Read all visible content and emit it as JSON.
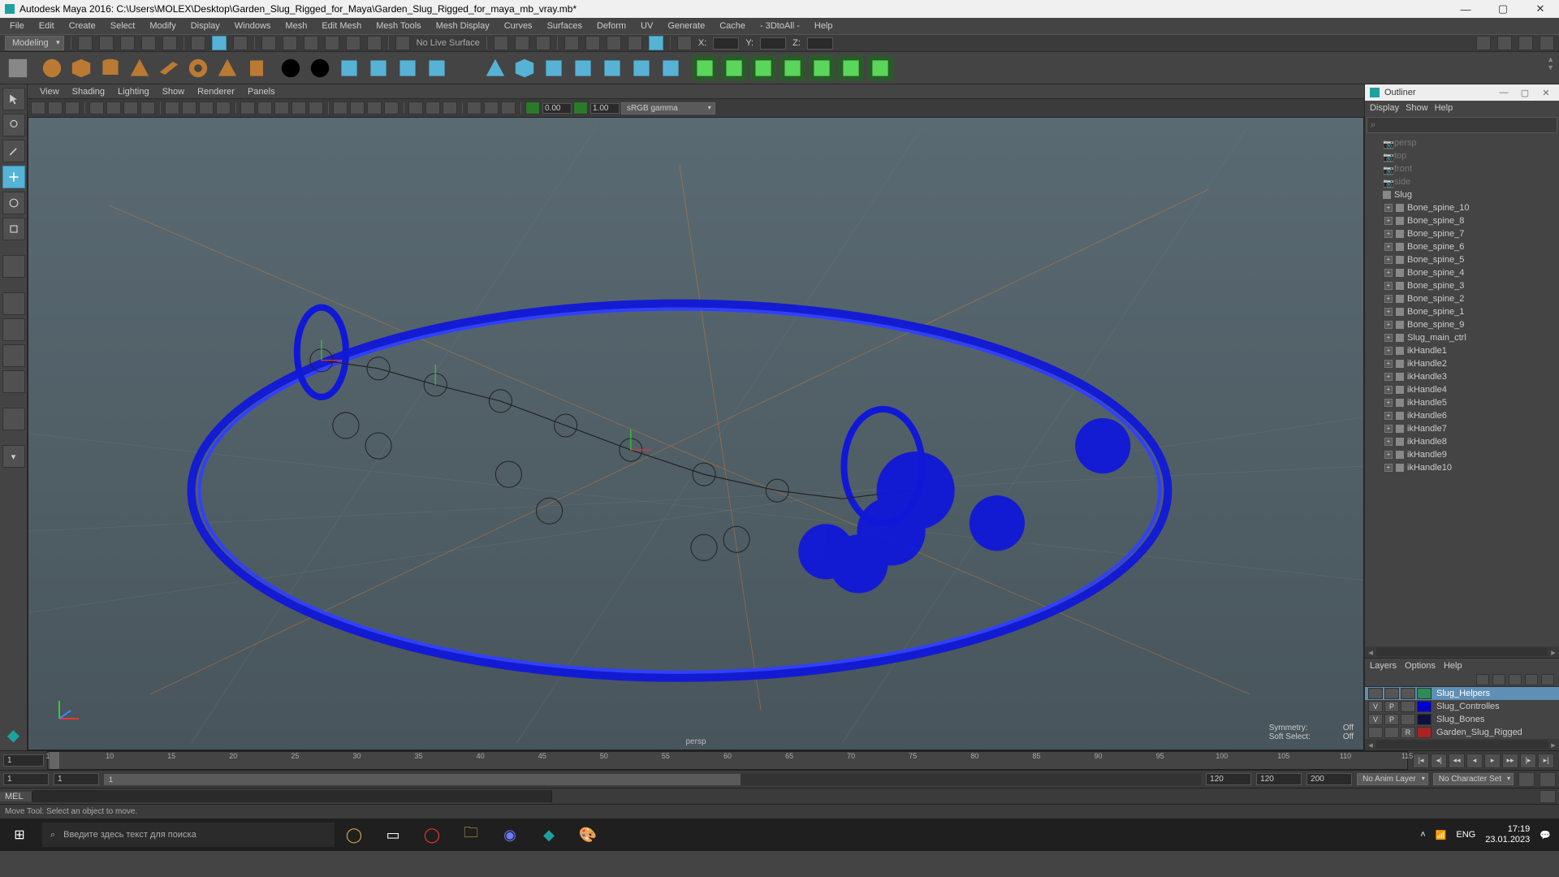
{
  "window": {
    "title": "Autodesk Maya 2016: C:\\Users\\MOLEX\\Desktop\\Garden_Slug_Rigged_for_Maya\\Garden_Slug_Rigged_for_maya_mb_vray.mb*"
  },
  "menu": [
    "File",
    "Edit",
    "Create",
    "Select",
    "Modify",
    "Display",
    "Windows",
    "Mesh",
    "Edit Mesh",
    "Mesh Tools",
    "Mesh Display",
    "Curves",
    "Surfaces",
    "Deform",
    "UV",
    "Generate",
    "Cache",
    "- 3DtoAll -",
    "Help"
  ],
  "workspace_dropdown": "Modeling",
  "no_live_surface": "No Live Surface",
  "xform": {
    "x_label": "X:",
    "y_label": "Y:",
    "z_label": "Z:",
    "x": "",
    "y": "",
    "z": ""
  },
  "panel_menu": [
    "View",
    "Shading",
    "Lighting",
    "Show",
    "Renderer",
    "Panels"
  ],
  "gamma_dropdown": "sRGB gamma",
  "vp_num_a": "0.00",
  "vp_num_b": "1.00",
  "viewport": {
    "camera": "persp",
    "hud": {
      "symmetry_label": "Symmetry:",
      "symmetry_val": "Off",
      "softsel_label": "Soft Select:",
      "softsel_val": "Off"
    }
  },
  "outliner": {
    "title": "Outliner",
    "menu": [
      "Display",
      "Show",
      "Help"
    ],
    "nodes": [
      {
        "label": "persp",
        "icon": "cam",
        "dim": true,
        "indent": 0,
        "expand": false
      },
      {
        "label": "top",
        "icon": "cam",
        "dim": true,
        "indent": 0,
        "expand": false
      },
      {
        "label": "front",
        "icon": "cam",
        "dim": true,
        "indent": 0,
        "expand": false
      },
      {
        "label": "side",
        "icon": "cam",
        "dim": true,
        "indent": 0,
        "expand": false
      },
      {
        "label": "Slug",
        "icon": "curve",
        "dim": false,
        "indent": 0,
        "expand": false
      },
      {
        "label": "Bone_spine_10",
        "icon": "joint",
        "dim": false,
        "indent": 1,
        "expand": true
      },
      {
        "label": "Bone_spine_8",
        "icon": "joint",
        "dim": false,
        "indent": 1,
        "expand": true
      },
      {
        "label": "Bone_spine_7",
        "icon": "joint",
        "dim": false,
        "indent": 1,
        "expand": true
      },
      {
        "label": "Bone_spine_6",
        "icon": "joint",
        "dim": false,
        "indent": 1,
        "expand": true
      },
      {
        "label": "Bone_spine_5",
        "icon": "joint",
        "dim": false,
        "indent": 1,
        "expand": true
      },
      {
        "label": "Bone_spine_4",
        "icon": "joint",
        "dim": false,
        "indent": 1,
        "expand": true
      },
      {
        "label": "Bone_spine_3",
        "icon": "joint",
        "dim": false,
        "indent": 1,
        "expand": true
      },
      {
        "label": "Bone_spine_2",
        "icon": "joint",
        "dim": false,
        "indent": 1,
        "expand": true
      },
      {
        "label": "Bone_spine_1",
        "icon": "joint",
        "dim": false,
        "indent": 1,
        "expand": true
      },
      {
        "label": "Bone_spine_9",
        "icon": "joint",
        "dim": false,
        "indent": 1,
        "expand": true
      },
      {
        "label": "Slug_main_ctrl",
        "icon": "curve",
        "dim": false,
        "indent": 1,
        "expand": true
      },
      {
        "label": "ikHandle1",
        "icon": "ik",
        "dim": false,
        "indent": 1,
        "expand": true
      },
      {
        "label": "ikHandle2",
        "icon": "ik",
        "dim": false,
        "indent": 1,
        "expand": true
      },
      {
        "label": "ikHandle3",
        "icon": "ik",
        "dim": false,
        "indent": 1,
        "expand": true
      },
      {
        "label": "ikHandle4",
        "icon": "ik",
        "dim": false,
        "indent": 1,
        "expand": true
      },
      {
        "label": "ikHandle5",
        "icon": "ik",
        "dim": false,
        "indent": 1,
        "expand": true
      },
      {
        "label": "ikHandle6",
        "icon": "ik",
        "dim": false,
        "indent": 1,
        "expand": true
      },
      {
        "label": "ikHandle7",
        "icon": "ik",
        "dim": false,
        "indent": 1,
        "expand": true
      },
      {
        "label": "ikHandle8",
        "icon": "ik",
        "dim": false,
        "indent": 1,
        "expand": true
      },
      {
        "label": "ikHandle9",
        "icon": "ik",
        "dim": false,
        "indent": 1,
        "expand": true
      },
      {
        "label": "ikHandle10",
        "icon": "ik",
        "dim": false,
        "indent": 1,
        "expand": true
      }
    ]
  },
  "layers_menu": [
    "Layers",
    "Options",
    "Help"
  ],
  "layers": [
    {
      "v": "",
      "p": "",
      "r": "",
      "color": "#2e8b57",
      "name": "Slug_Helpers",
      "selected": true
    },
    {
      "v": "V",
      "p": "P",
      "r": "",
      "color": "#0000cc",
      "name": "Slug_Controlles",
      "selected": false
    },
    {
      "v": "V",
      "p": "P",
      "r": "",
      "color": "#101040",
      "name": "Slug_Bones",
      "selected": false
    },
    {
      "v": "",
      "p": "",
      "r": "R",
      "color": "#aa2222",
      "name": "Garden_Slug_Rigged",
      "selected": false
    }
  ],
  "timeline": {
    "start_field": "1",
    "ticks": [
      "1",
      "10",
      "15",
      "20",
      "25",
      "30",
      "35",
      "40",
      "45",
      "50",
      "55",
      "60",
      "65",
      "70",
      "75",
      "80",
      "85",
      "90",
      "95",
      "100",
      "105",
      "110",
      "115"
    ]
  },
  "range": {
    "start": "1",
    "inner_start": "1",
    "inner_thumb": "1",
    "inner_end": "120",
    "end": "120",
    "end2": "200",
    "anim_layer": "No Anim Layer",
    "char_set": "No Character Set"
  },
  "cmd": {
    "lang": "MEL"
  },
  "helpline": "Move Tool: Select an object to move.",
  "taskbar": {
    "search_placeholder": "Введите здесь текст для поиска",
    "lang": "ENG",
    "time": "17:19",
    "date": "23.01.2023"
  }
}
